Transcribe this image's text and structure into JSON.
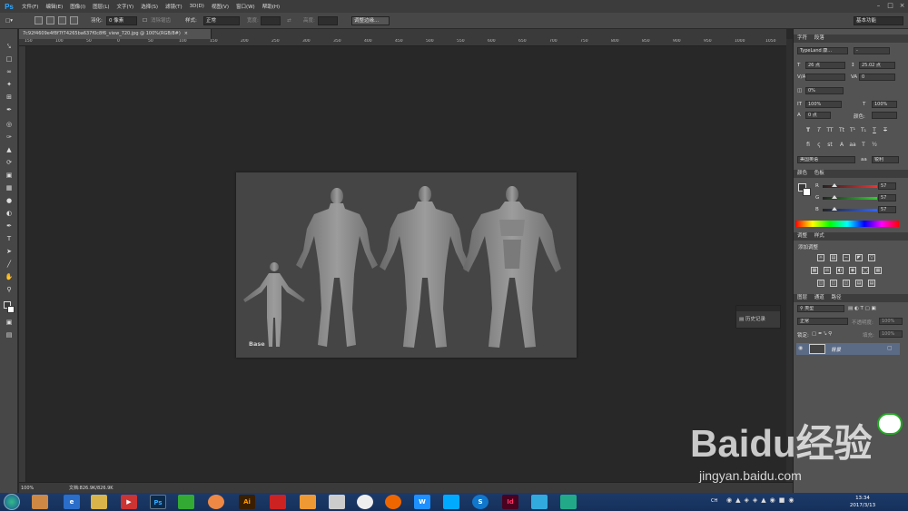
{
  "app": {
    "logo": "Ps"
  },
  "menu": [
    "文件(F)",
    "编辑(E)",
    "图像(I)",
    "图层(L)",
    "文字(Y)",
    "选择(S)",
    "滤镜(T)",
    "3D(D)",
    "视图(V)",
    "窗口(W)",
    "帮助(H)"
  ],
  "options": {
    "feather_label": "羽化:",
    "feather_value": "0 像素",
    "antialias_label": "消除锯齿",
    "style_label": "样式:",
    "style_value": "正常",
    "width_label": "宽度:",
    "height_label": "高度:",
    "refine_button": "调整边缘...",
    "workspace": "基本功能"
  },
  "document": {
    "tab_title": "7c92f4609e4f8f7f74265ba637f0c8f6_view_720.jpg @ 100%(RGB/8#)",
    "canvas_label": "Base",
    "zoom": "100%",
    "doc_size": "文档:826.9K/826.9K"
  },
  "ruler_ticks": [
    "150",
    "100",
    "50",
    "0",
    "50",
    "100",
    "150",
    "200",
    "250",
    "300",
    "350",
    "400",
    "450",
    "500",
    "550",
    "600",
    "650",
    "700",
    "750",
    "800",
    "850",
    "900",
    "950",
    "1000",
    "1050"
  ],
  "history_panel": {
    "label": "历史记录"
  },
  "character_panel": {
    "tabs": [
      "字符",
      "段落"
    ],
    "font_family": "TypeLand 康...",
    "font_style": "-",
    "font_size": "26 点",
    "leading": "25.02 点",
    "kerning": "0",
    "tracking": "0%",
    "vertical_scale": "100%",
    "horizontal_scale": "100%",
    "baseline": "0 点",
    "color_label": "颜色:",
    "language": "美国英语",
    "aa_symbol": "aa",
    "aa_mode": "锐利"
  },
  "color_panel": {
    "tabs": [
      "颜色",
      "色板"
    ],
    "channels": [
      {
        "label": "R",
        "value": "57"
      },
      {
        "label": "G",
        "value": "57"
      },
      {
        "label": "B",
        "value": "57"
      }
    ],
    "fill_fraction": 0.22,
    "colors": {
      "r_track": "#e33",
      "g_track": "#3c3",
      "b_track": "#36f"
    }
  },
  "adjustments_panel": {
    "tabs": [
      "调整",
      "样式"
    ],
    "title": "添加调整"
  },
  "layers_panel": {
    "tabs": [
      "图层",
      "通道",
      "路径"
    ],
    "filter": "类型",
    "blend_mode": "正常",
    "opacity_label": "不透明度:",
    "opacity_value": "100%",
    "lock_label": "锁定:",
    "fill_label": "填充:",
    "fill_value": "100%",
    "layer_name": "背景"
  },
  "taskbar": {
    "apps": [
      "Ps",
      "Ai",
      "Id"
    ],
    "time": "13:34",
    "date": "2017/3/13",
    "lang": "CH"
  },
  "watermark": {
    "brand": "Baidu经验",
    "url": "jingyan.baidu.com"
  }
}
